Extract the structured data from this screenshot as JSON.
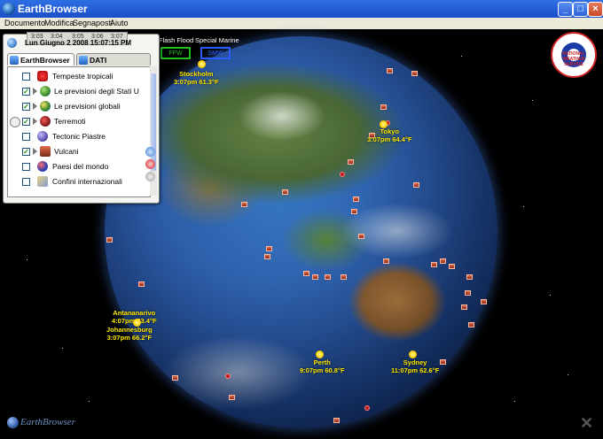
{
  "window": {
    "title": "EarthBrowser"
  },
  "menu": [
    "Documento",
    "Modifica",
    "Segnaposti",
    "Aiuto"
  ],
  "timebar": {
    "ticks": [
      "3:03",
      "3:04",
      "3:05",
      "3:06",
      "3:07"
    ]
  },
  "panel": {
    "date": "Lun Giugno 2 2008 15:07:15 PM",
    "tabs": [
      {
        "label": "EarthBrowser",
        "active": true
      },
      {
        "label": "DATI PERSONALI",
        "active": false
      }
    ],
    "layers": [
      {
        "label": "Tempeste tropicali",
        "checked": false,
        "icon": "hurricane-icon"
      },
      {
        "label": "Le previsioni degli Stati U",
        "checked": true,
        "icon": "us-forecast-icon"
      },
      {
        "label": "Le previsioni globali",
        "checked": true,
        "icon": "global-forecast-icon"
      },
      {
        "label": "Terremoti",
        "checked": true,
        "icon": "earthquake-icon"
      },
      {
        "label": "Tectonic Piastre",
        "checked": false,
        "icon": "tectonic-plates-icon"
      },
      {
        "label": "Vulcani",
        "checked": true,
        "icon": "volcano-icon"
      },
      {
        "label": "Paesi del mondo",
        "checked": false,
        "icon": "countries-icon"
      },
      {
        "label": "Confini internazionali",
        "checked": false,
        "icon": "borders-icon"
      }
    ]
  },
  "legend": {
    "flash_flood": "Flash Flood",
    "flash_flood_code": "FFW",
    "special_marine": "Special Marine",
    "special_marine_code": "SMW"
  },
  "nws": {
    "text": "NATIONAL WEATHER SERVICE"
  },
  "cities": {
    "stockholm": {
      "name": "Stockholm",
      "time": "3:07pm 61.3°F"
    },
    "tokyo": {
      "name": "Tokyo",
      "time": "3:07pm 64.4°F"
    },
    "antananarivo": {
      "name": "Antananarivo",
      "time": "4:07pm 73.4°F"
    },
    "johannesburg": {
      "name": "Johannesburg",
      "time": "3:07pm 66.2°F"
    },
    "perth": {
      "name": "Perth",
      "time": "9:07pm 60.8°F"
    },
    "sydney": {
      "name": "Sydney",
      "time": "11:07pm 62.6°F"
    }
  },
  "brand": {
    "text": "EarthBrowser"
  }
}
